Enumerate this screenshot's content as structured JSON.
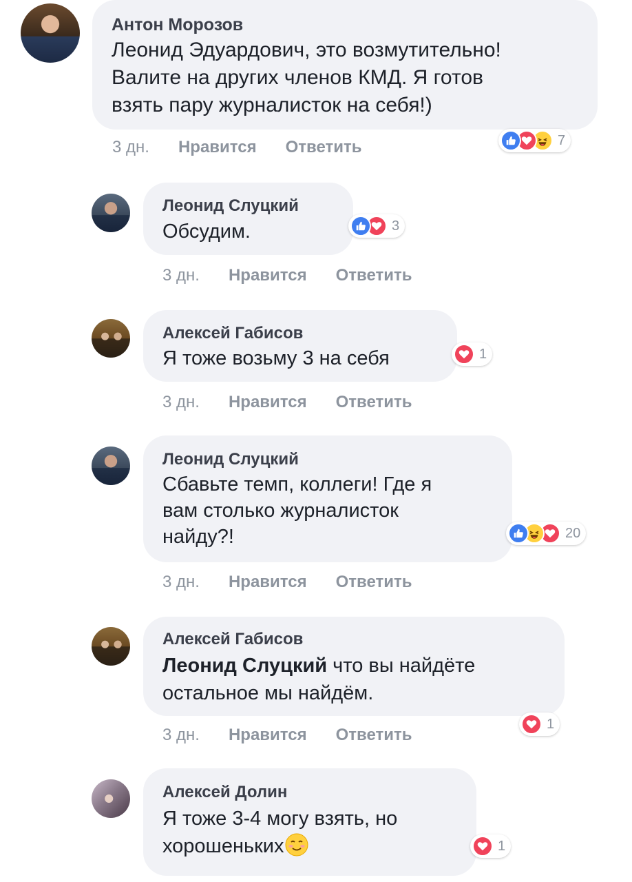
{
  "comments": [
    {
      "author": "Антон Морозов",
      "text": "Леонид Эдуардович, это возмутительно!\nВалите на других членов КМД. Я готов\nвзять пару журналисток на себя!)",
      "time": "3 дн.",
      "like_label": "Нравится",
      "reply_label": "Ответить",
      "reactions": [
        "like-icon",
        "love-icon",
        "haha-icon"
      ],
      "reaction_count": "7"
    },
    {
      "author": "Леонид Слуцкий",
      "text": "Обсудим.",
      "time": "3 дн.",
      "like_label": "Нравится",
      "reply_label": "Ответить",
      "reactions": [
        "like-icon",
        "love-icon"
      ],
      "reaction_count": "3"
    },
    {
      "author": "Алексей Габисов",
      "text": "Я тоже возьму 3 на себя",
      "time": "3 дн.",
      "like_label": "Нравится",
      "reply_label": "Ответить",
      "reactions": [
        "love-icon"
      ],
      "reaction_count": "1"
    },
    {
      "author": "Леонид Слуцкий",
      "text": "Сбавьте темп, коллеги! Где я\nвам столько журналисток\nнайду?!",
      "time": "3 дн.",
      "like_label": "Нравится",
      "reply_label": "Ответить",
      "reactions": [
        "like-icon",
        "haha-icon",
        "love-icon"
      ],
      "reaction_count": "20"
    },
    {
      "author": "Алексей Габисов",
      "mention": "Леонид Слуцкий",
      "text": " что вы найдёте\nостальное мы найдём.",
      "time": "3 дн.",
      "like_label": "Нравится",
      "reply_label": "Ответить",
      "reactions": [
        "love-icon"
      ],
      "reaction_count": "1"
    },
    {
      "author": "Алексей Долин",
      "text": "Я тоже 3-4 могу взять, но\nхорошеньких",
      "emoji": "smiling-face-icon",
      "reactions": [
        "love-icon"
      ],
      "reaction_count": "1"
    }
  ],
  "colors": {
    "bubble": "#f1f2f6",
    "like": "#3f7ef0",
    "love": "#f0435a",
    "haha": "#ffd03e",
    "meta": "#8d949e"
  }
}
